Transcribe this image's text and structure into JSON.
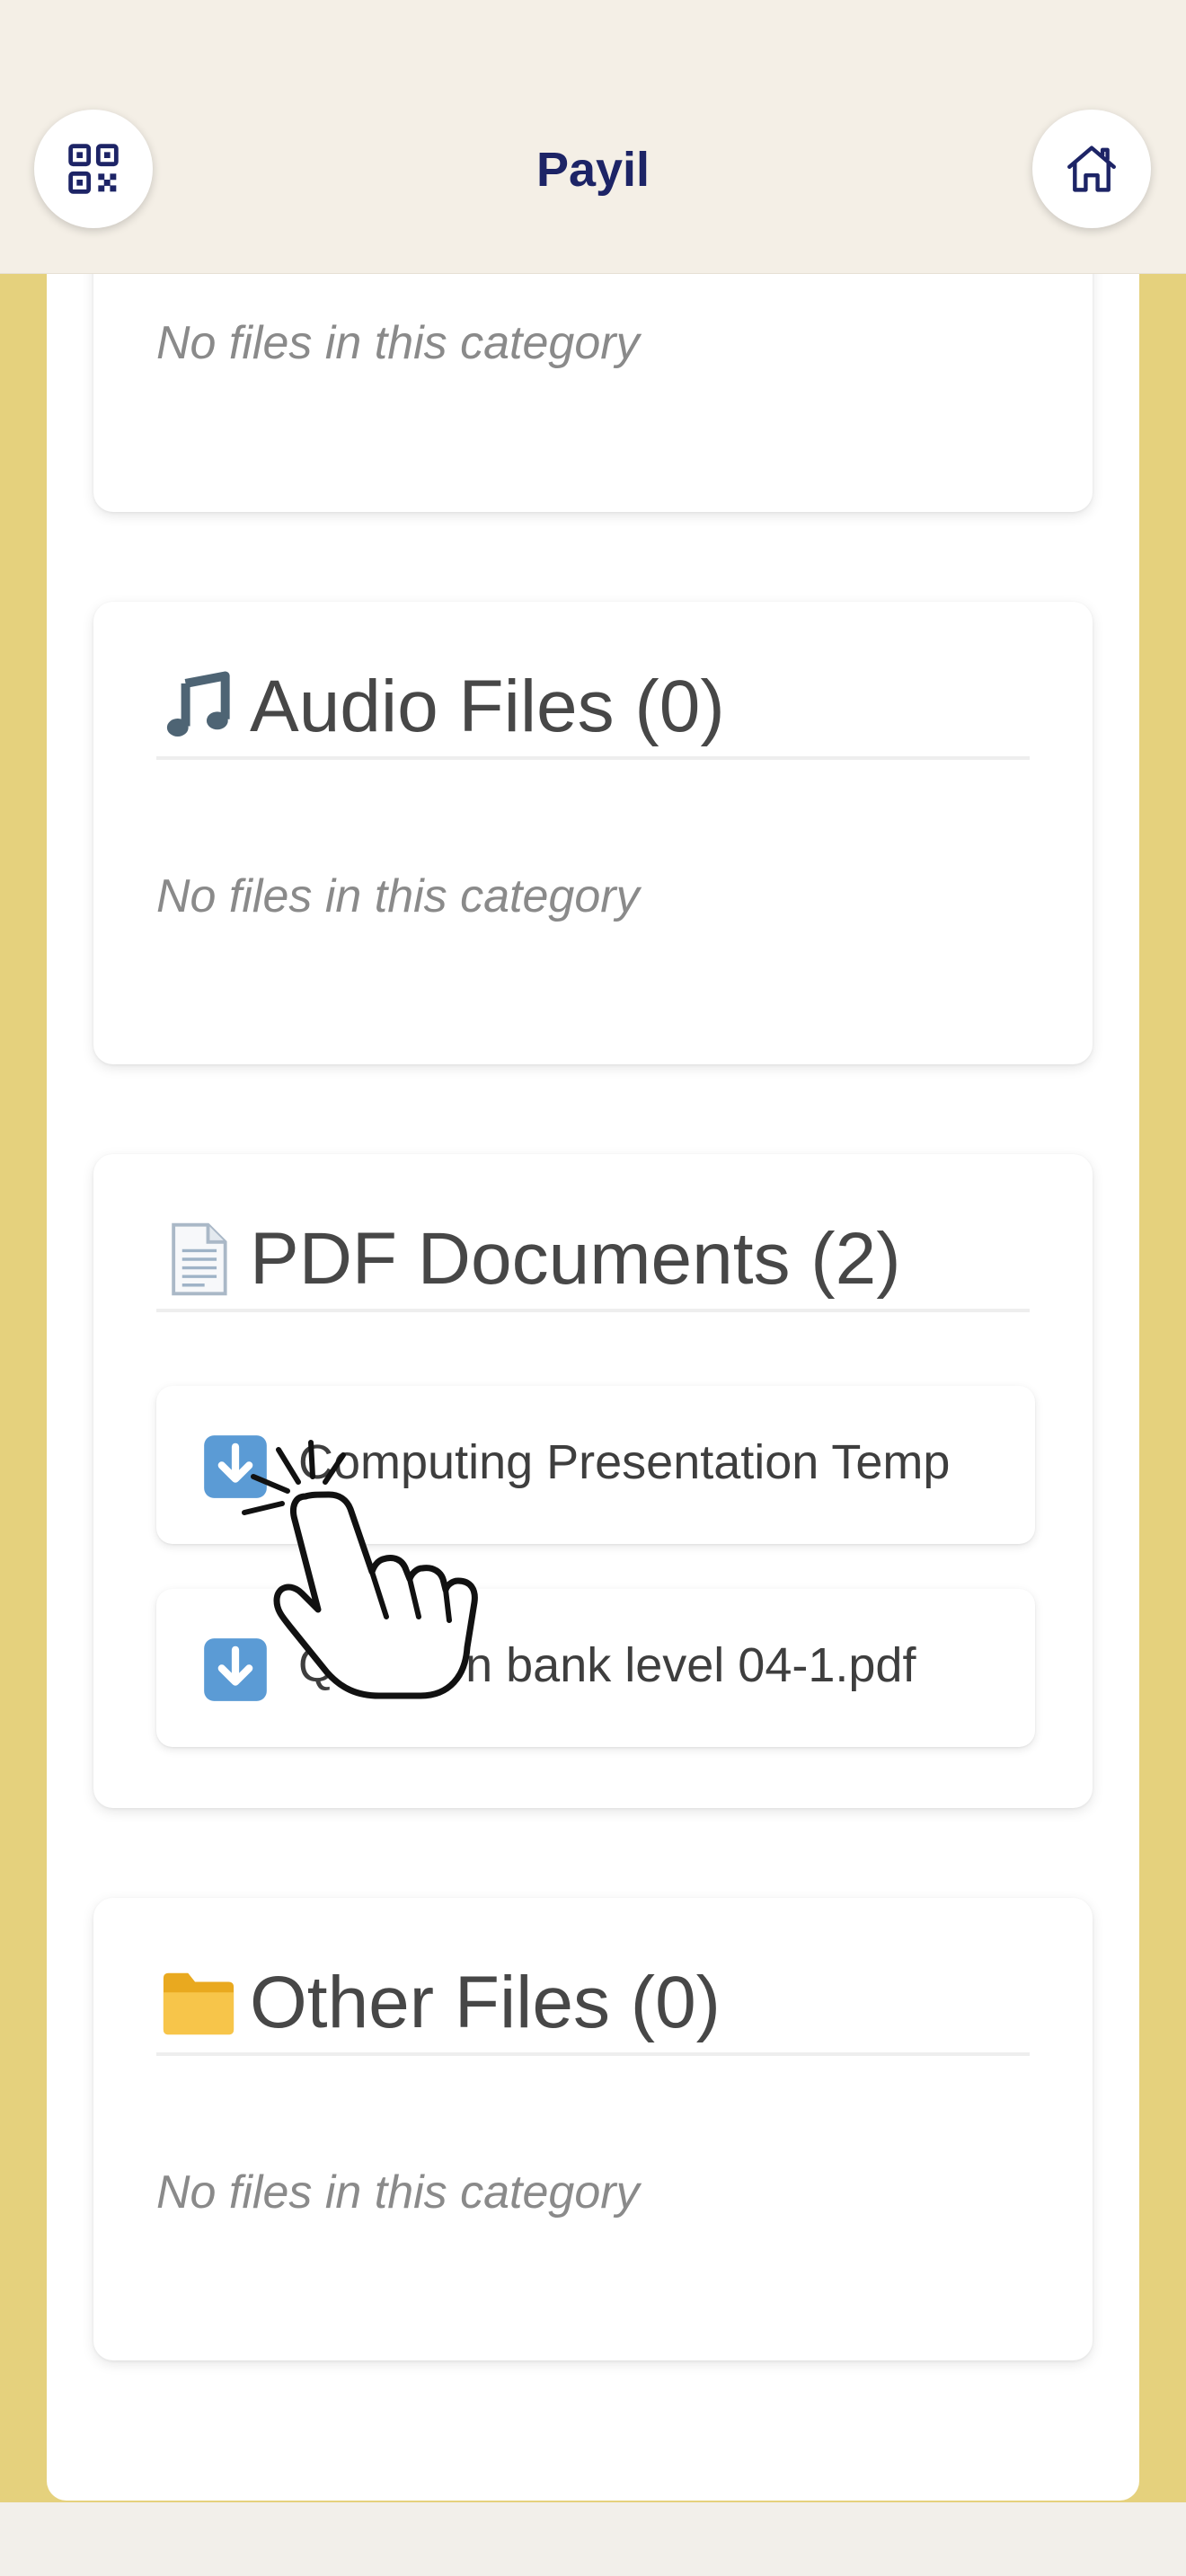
{
  "header": {
    "title": "Payil",
    "qr_icon": "qr-code-icon",
    "home_icon": "home-icon"
  },
  "sections": [
    {
      "id": "previous",
      "empty_text": "No files in this category"
    },
    {
      "id": "audio",
      "icon": "music-note-icon",
      "title": "Audio Files (0)",
      "empty_text": "No files in this category"
    },
    {
      "id": "pdf",
      "icon": "document-icon",
      "title": "PDF Documents (2)",
      "files": [
        {
          "name": "Computing Presentation Temp",
          "icon": "download-arrow-icon"
        },
        {
          "name": "Question bank level 04-1.pdf",
          "icon": "download-arrow-icon"
        }
      ]
    },
    {
      "id": "other",
      "icon": "folder-icon",
      "title": "Other Files (0)",
      "empty_text": "No files in this category"
    }
  ],
  "colors": {
    "header_bg": "#f4efe6",
    "title": "#1d2466",
    "page_bg": "#e5d17d",
    "section_title": "#474747",
    "muted": "#8a8a8a"
  },
  "overlay": {
    "cursor_icon": "tap-hand-cursor-icon"
  }
}
